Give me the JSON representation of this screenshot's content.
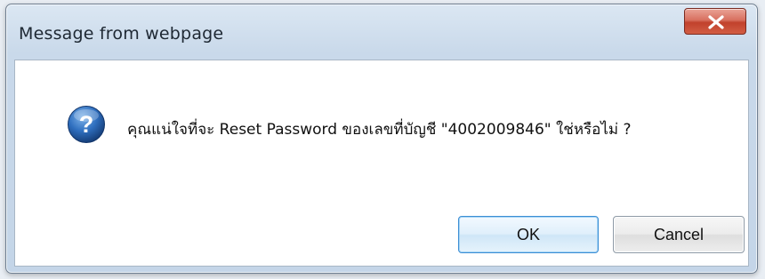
{
  "dialog": {
    "title": "Message from webpage",
    "message": "คุณแน่ใจที่จะ Reset Password ของเลขที่บัญชี \"4002009846\" ใช่หรือไม่ ?",
    "icon": "question-icon",
    "buttons": {
      "ok_label": "OK",
      "cancel_label": "Cancel"
    }
  },
  "colors": {
    "close_button": "#c94a35",
    "question_icon": "#1f5fa8",
    "ok_border": "#3c8ed4"
  }
}
